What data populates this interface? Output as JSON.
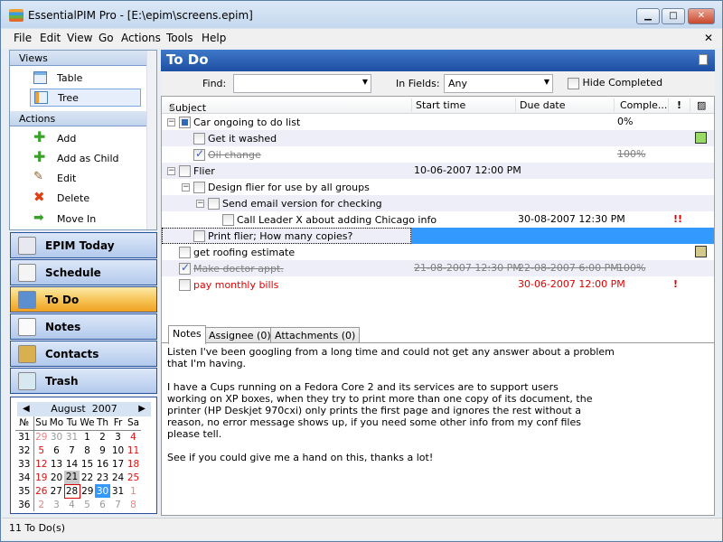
{
  "window": {
    "title": "EssentialPIM Pro - [E:\\epim\\screens.epim]",
    "minimize": "▁",
    "maximize": "□",
    "close": "✕"
  },
  "menu": [
    "File",
    "Edit",
    "View",
    "Go",
    "Actions",
    "Tools",
    "Help"
  ],
  "menu_close": "✕",
  "views": {
    "header": "Views",
    "items": [
      {
        "label": "Table",
        "icon": "table-icon"
      },
      {
        "label": "Tree",
        "icon": "tree-icon",
        "selected": true
      }
    ]
  },
  "actions": {
    "header": "Actions",
    "items": [
      {
        "label": "Add",
        "icon": "plus-icon"
      },
      {
        "label": "Add as Child",
        "icon": "plus-child-icon"
      },
      {
        "label": "Edit",
        "icon": "pencil-icon"
      },
      {
        "label": "Delete",
        "icon": "delete-x-icon"
      },
      {
        "label": "Move In",
        "icon": "arrow-right-icon"
      }
    ]
  },
  "nav": [
    {
      "label": "EPIM Today",
      "icon": "today-icon"
    },
    {
      "label": "Schedule",
      "icon": "calendar-icon"
    },
    {
      "label": "To Do",
      "icon": "todo-icon",
      "active": true
    },
    {
      "label": "Notes",
      "icon": "notes-icon"
    },
    {
      "label": "Contacts",
      "icon": "contacts-icon"
    },
    {
      "label": "Trash",
      "icon": "trash-icon"
    }
  ],
  "calendar": {
    "month": "August",
    "year": "2007",
    "prev": "◀",
    "next": "▶",
    "week_label": "№",
    "weekdays": [
      "Su",
      "Mo",
      "Tu",
      "We",
      "Th",
      "Fr",
      "Sa"
    ],
    "weeks": [
      {
        "n": "31",
        "d": [
          "29",
          "30",
          "31",
          "1",
          "2",
          "3",
          "4"
        ]
      },
      {
        "n": "32",
        "d": [
          "5",
          "6",
          "7",
          "8",
          "9",
          "10",
          "11"
        ]
      },
      {
        "n": "33",
        "d": [
          "12",
          "13",
          "14",
          "15",
          "16",
          "17",
          "18"
        ]
      },
      {
        "n": "34",
        "d": [
          "19",
          "20",
          "21",
          "22",
          "23",
          "24",
          "25"
        ]
      },
      {
        "n": "35",
        "d": [
          "26",
          "27",
          "28",
          "29",
          "30",
          "31",
          "1"
        ]
      },
      {
        "n": "36",
        "d": [
          "2",
          "3",
          "4",
          "5",
          "6",
          "7",
          "8"
        ]
      }
    ],
    "today": "28",
    "selected": "30",
    "highlighted": "21"
  },
  "status": "11 To Do(s)",
  "main": {
    "title": "To Do",
    "find_label": "Find:",
    "find_value": "",
    "in_fields_label": "In Fields:",
    "in_fields_value": "Any",
    "hide_completed_label": "Hide Completed",
    "hide_completed": false
  },
  "columns": {
    "subject": "Subject",
    "start": "Start time",
    "due": "Due date",
    "complete": "Comple...",
    "priority": "!",
    "color": "▨"
  },
  "colors": {
    "selection": "#3399ff",
    "green_tag": "#99d966",
    "tan_tag": "#d4c98c",
    "overdue": "#e00000"
  },
  "tasks": [
    {
      "subject": "Car ongoing to do list",
      "level": 0,
      "expander": "−",
      "state": "partial",
      "start": "",
      "due": "",
      "complete": "0%",
      "priority": "",
      "color": ""
    },
    {
      "subject": "Get it washed",
      "level": 1,
      "state": "",
      "start": "",
      "due": "",
      "complete": "",
      "priority": "",
      "color": "#99d966"
    },
    {
      "subject": "Oil change",
      "level": 1,
      "state": "checked",
      "done": true,
      "start": "",
      "due": "",
      "complete": "100%",
      "priority": "",
      "color": ""
    },
    {
      "subject": "Flier",
      "level": 0,
      "expander": "−",
      "state": "",
      "start": "10-06-2007 12:00 PM",
      "due": "",
      "complete": "",
      "priority": "",
      "color": ""
    },
    {
      "subject": "Design flier for use by all groups",
      "level": 1,
      "expander": "−",
      "state": "",
      "start": "",
      "due": "",
      "complete": "",
      "priority": "",
      "color": ""
    },
    {
      "subject": "Send email version for checking",
      "level": 2,
      "expander": "−",
      "state": "",
      "start": "",
      "due": "",
      "complete": "",
      "priority": "",
      "color": ""
    },
    {
      "subject": "Call Leader X about adding Chicago info",
      "level": 3,
      "state": "",
      "start": "",
      "due": "30-08-2007 12:30 PM",
      "complete": "",
      "priority": "!!",
      "color": ""
    },
    {
      "subject": "Print flier; How many copies?",
      "level": 1,
      "state": "",
      "selected": true,
      "start": "",
      "due": "",
      "complete": "",
      "priority": "",
      "color": ""
    },
    {
      "subject": "get roofing estimate",
      "level": 0,
      "state": "",
      "start": "",
      "due": "",
      "complete": "",
      "priority": "",
      "color": "#d4c98c"
    },
    {
      "subject": "Make doctor appt.",
      "level": 0,
      "state": "checked",
      "done": true,
      "start": "21-08-2007 12:30 PM",
      "due": "22-08-2007 6:00 PM",
      "complete": "100%",
      "priority": "",
      "color": ""
    },
    {
      "subject": "pay monthly bills",
      "level": 0,
      "state": "",
      "overdue": true,
      "start": "",
      "due": "30-06-2007 12:00 PM",
      "complete": "",
      "priority": "!",
      "color": ""
    }
  ],
  "tabs": [
    "Notes",
    "Assignee (0)",
    "Attachments (0)"
  ],
  "notes": "Listen I've been googling from a long time and could not get any answer about a problem\nthat I'm having.\n\nI have a Cups running on a Fedora Core 2 and its services are to support users\nworking on XP boxes, when they try to print more than one copy of its document, the\nprinter (HP Deskjet 970cxi) only prints the first page and ignores the rest without a\nreason, no error message shows up, if you need some other info from my conf files\nplease tell.\n\nSee if you could give me a hand on this, thanks a lot!"
}
